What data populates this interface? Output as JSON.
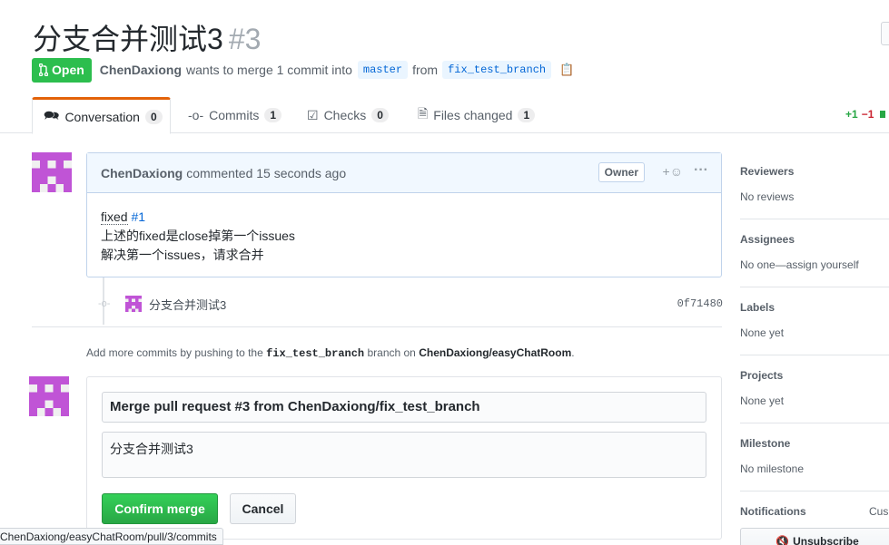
{
  "pr": {
    "title": "分支合并测试3",
    "number": "#3",
    "state": "Open",
    "author": "ChenDaxiong",
    "merge_text": "wants to merge 1 commit into",
    "base_branch": "master",
    "from_text": "from",
    "head_branch": "fix_test_branch"
  },
  "tabs": [
    {
      "label": "Conversation",
      "count": "0"
    },
    {
      "label": "Commits",
      "count": "1"
    },
    {
      "label": "Checks",
      "count": "0"
    },
    {
      "label": "Files changed",
      "count": "1"
    }
  ],
  "diffstat": {
    "additions": "+1",
    "deletions": "−1"
  },
  "comment": {
    "author": "ChenDaxiong",
    "action": "commented 15 seconds ago",
    "badge": "Owner",
    "line1_prefix": "fixed",
    "line1_link": "#1",
    "line2": "上述的fixed是close掉第一个issues",
    "line3": "解决第一个issues，请求合并"
  },
  "commit": {
    "message": "分支合并测试3",
    "sha": "0f71480"
  },
  "hint": {
    "prefix": "Add more commits by pushing to the",
    "branch": "fix_test_branch",
    "middle": "branch on",
    "repo": "ChenDaxiong/easyChatRoom",
    "suffix": "."
  },
  "merge": {
    "title_value": "Merge pull request #3 from ChenDaxiong/fix_test_branch",
    "message_value": "分支合并测试3",
    "confirm_label": "Confirm merge",
    "cancel_label": "Cancel"
  },
  "statusbar": {
    "url": "ChenDaxiong/easyChatRoom/pull/3/commits"
  },
  "sidebar": {
    "reviewers": {
      "label": "Reviewers",
      "value": "No reviews"
    },
    "assignees": {
      "label": "Assignees",
      "value": "No one—assign yourself"
    },
    "labels": {
      "label": "Labels",
      "value": "None yet"
    },
    "projects": {
      "label": "Projects",
      "value": "None yet"
    },
    "milestone": {
      "label": "Milestone",
      "value": "No milestone"
    },
    "notifications": {
      "label": "Notifications",
      "customize": "Cus",
      "unsubscribe": "Unsubscribe"
    }
  },
  "colors": {
    "open_green": "#2cbe4e",
    "avatar_purple": "#c054d6",
    "link_blue": "#0366d6",
    "tab_accent": "#e36209"
  }
}
